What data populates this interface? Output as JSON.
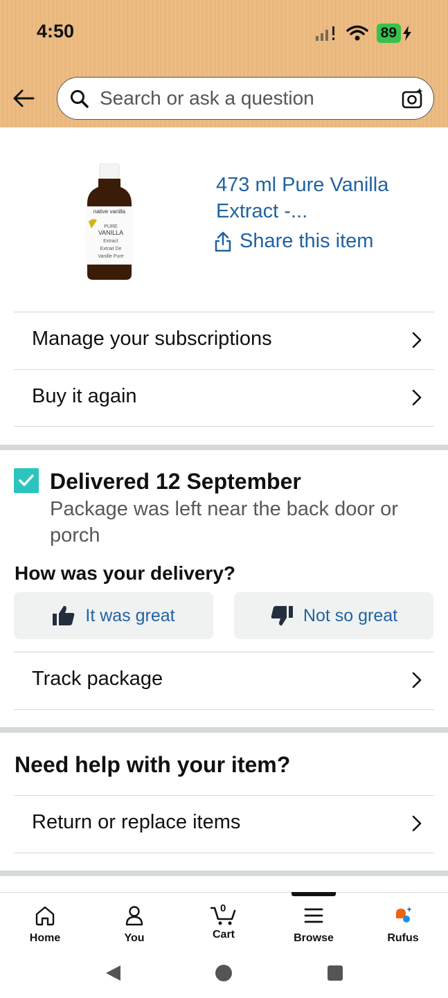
{
  "status": {
    "time": "4:50",
    "battery": "89"
  },
  "search": {
    "placeholder": "Search or ask a question"
  },
  "product": {
    "title": "473 ml Pure Vanilla Extract -...",
    "share": "Share this item",
    "bottle_label": {
      "brand": "native vanilla",
      "line1": "PURE",
      "line2": "VANILLA",
      "line3": "Extract",
      "line4": "Extrait De",
      "line5": "Vanille Pure"
    }
  },
  "rows": {
    "subscriptions": "Manage your subscriptions",
    "buy_again": "Buy it again",
    "track": "Track package",
    "return": "Return or replace items"
  },
  "delivery": {
    "title": "Delivered 12 September",
    "subtitle": "Package was left near the back door or porch",
    "question": "How was your delivery?",
    "great": "It was great",
    "not_great": "Not so great"
  },
  "help": {
    "title": "Need help with your item?"
  },
  "nav": {
    "home": "Home",
    "you": "You",
    "cart": "Cart",
    "cart_count": "0",
    "browse": "Browse",
    "rufus": "Rufus"
  },
  "colors": {
    "header": "#ecbd85",
    "link": "#2162a1",
    "check": "#2cc5be",
    "battery": "#36c24a"
  }
}
